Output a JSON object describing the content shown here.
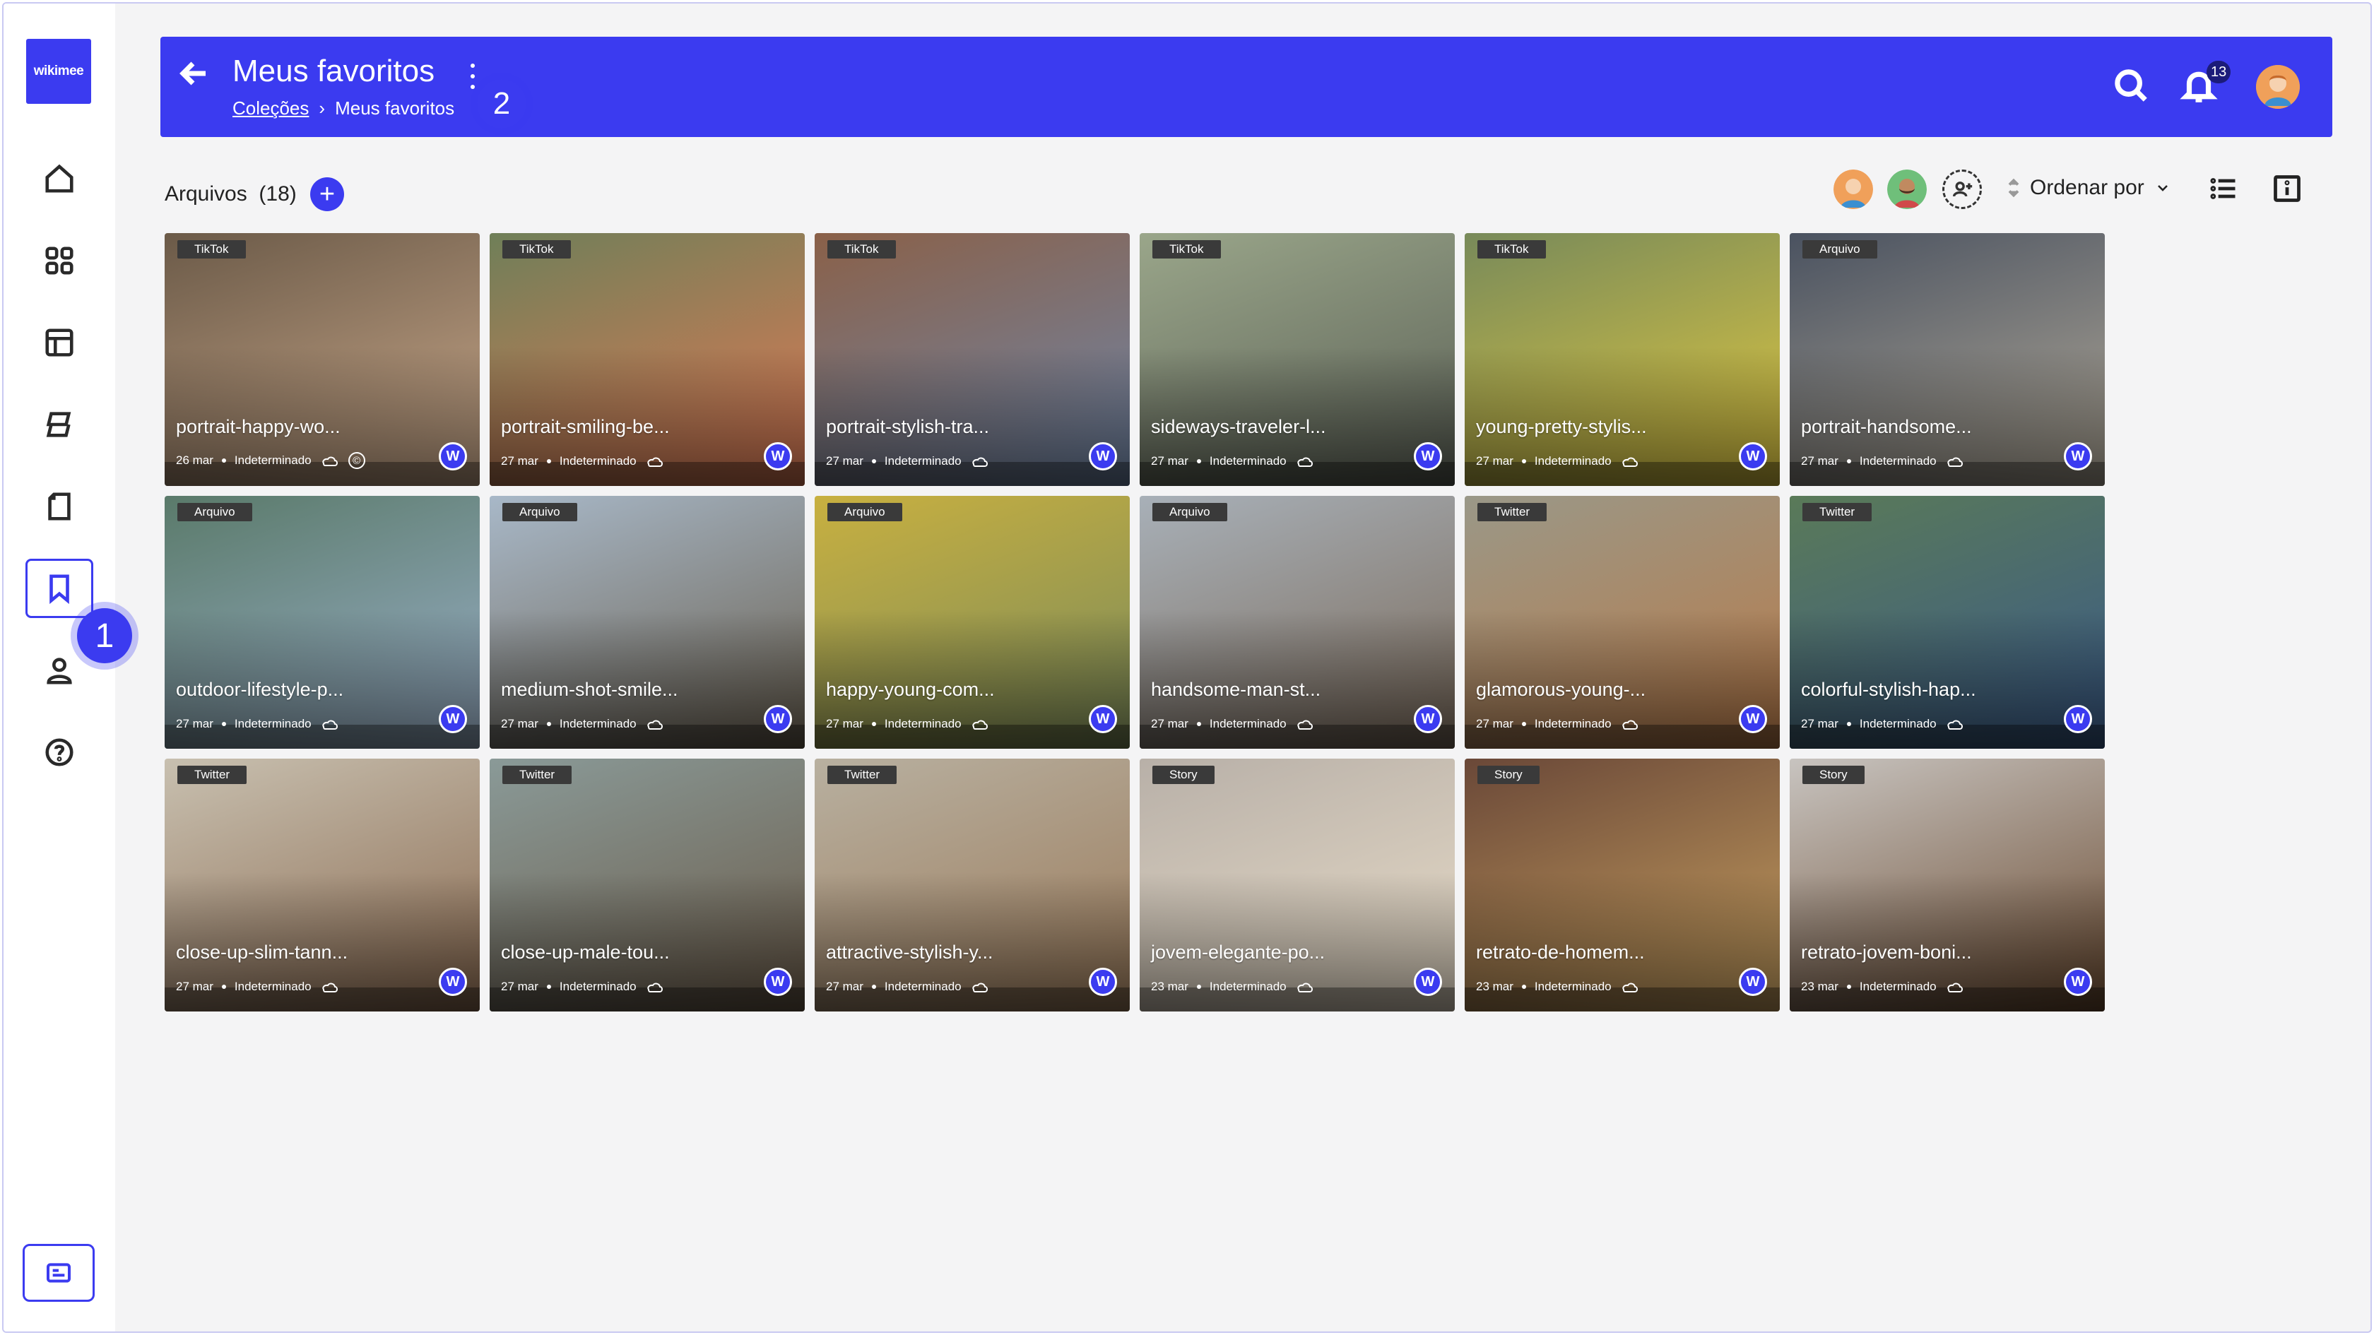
{
  "app": {
    "logo": "wikimee"
  },
  "sidebar": {
    "items": [
      {
        "name": "home",
        "icon": "home-icon",
        "active": false
      },
      {
        "name": "apps",
        "icon": "grid-icon",
        "active": false
      },
      {
        "name": "layout",
        "icon": "layout-icon",
        "active": false
      },
      {
        "name": "boards",
        "icon": "stack-icon",
        "active": false
      },
      {
        "name": "pages",
        "icon": "page-icon",
        "active": false
      },
      {
        "name": "favorites",
        "icon": "bookmark-icon",
        "active": true
      },
      {
        "name": "profile",
        "icon": "user-icon",
        "active": false
      },
      {
        "name": "help",
        "icon": "help-icon",
        "active": false
      }
    ],
    "step1": "1"
  },
  "header": {
    "title": "Meus favoritos",
    "breadcrumb_link": "Coleções",
    "breadcrumb_sep": "›",
    "breadcrumb_current": "Meus favoritos",
    "step2": "2",
    "notifications": "13"
  },
  "toolbar": {
    "files_label": "Arquivos",
    "files_count": "(18)",
    "add_label": "+",
    "sort_label": "Ordenar por"
  },
  "cards": [
    {
      "tag": "TikTok",
      "name": "portrait-happy-wo...",
      "date": "26 mar",
      "status": "Indeterminado",
      "copyright": true,
      "colors": [
        "#6b5a48",
        "#c9a88a"
      ]
    },
    {
      "tag": "TikTok",
      "name": "portrait-smiling-be...",
      "date": "27 mar",
      "status": "Indeterminado",
      "copyright": false,
      "colors": [
        "#6f7f58",
        "#e07a55"
      ]
    },
    {
      "tag": "TikTok",
      "name": "portrait-stylish-tra...",
      "date": "27 mar",
      "status": "Indeterminado",
      "copyright": false,
      "colors": [
        "#8a6048",
        "#6f86a8"
      ]
    },
    {
      "tag": "TikTok",
      "name": "sideways-traveler-l...",
      "date": "27 mar",
      "status": "Indeterminado",
      "copyright": false,
      "colors": [
        "#9aa68a",
        "#5a5f55"
      ]
    },
    {
      "tag": "TikTok",
      "name": "young-pretty-stylis...",
      "date": "27 mar",
      "status": "Indeterminado",
      "copyright": false,
      "colors": [
        "#788a5a",
        "#e0c840"
      ]
    },
    {
      "tag": "Arquivo",
      "name": "portrait-handsome...",
      "date": "27 mar",
      "status": "Indeterminado",
      "copyright": false,
      "colors": [
        "#4a5260",
        "#b0a898"
      ]
    },
    {
      "tag": "Arquivo",
      "name": "outdoor-lifestyle-p...",
      "date": "27 mar",
      "status": "Indeterminado",
      "copyright": false,
      "colors": [
        "#5a7a6a",
        "#9ab0c8"
      ]
    },
    {
      "tag": "Arquivo",
      "name": "medium-shot-smile...",
      "date": "27 mar",
      "status": "Indeterminado",
      "copyright": false,
      "colors": [
        "#a8b8c8",
        "#6a6050"
      ]
    },
    {
      "tag": "Arquivo",
      "name": "happy-young-com...",
      "date": "27 mar",
      "status": "Indeterminado",
      "copyright": false,
      "colors": [
        "#c8b040",
        "#7a8a5a"
      ]
    },
    {
      "tag": "Arquivo",
      "name": "handsome-man-st...",
      "date": "27 mar",
      "status": "Indeterminado",
      "copyright": false,
      "colors": [
        "#a8b0b8",
        "#7a6a5a"
      ]
    },
    {
      "tag": "Twitter",
      "name": "glamorous-young-...",
      "date": "27 mar",
      "status": "Indeterminado",
      "copyright": false,
      "colors": [
        "#9a9888",
        "#b87a48"
      ]
    },
    {
      "tag": "Twitter",
      "name": "colorful-stylish-hap...",
      "date": "27 mar",
      "status": "Indeterminado",
      "copyright": false,
      "colors": [
        "#5a7a58",
        "#3a5a88"
      ]
    },
    {
      "tag": "Twitter",
      "name": "close-up-slim-tann...",
      "date": "27 mar",
      "status": "Indeterminado",
      "copyright": false,
      "colors": [
        "#c8c0b0",
        "#8a6a50"
      ]
    },
    {
      "tag": "Twitter",
      "name": "close-up-male-tou...",
      "date": "27 mar",
      "status": "Indeterminado",
      "copyright": false,
      "colors": [
        "#8a9a98",
        "#6a5a48"
      ]
    },
    {
      "tag": "Twitter",
      "name": "attractive-stylish-y...",
      "date": "27 mar",
      "status": "Indeterminado",
      "copyright": false,
      "colors": [
        "#b8b0a0",
        "#9a7a5a"
      ]
    },
    {
      "tag": "Story",
      "name": "jovem-elegante-po...",
      "date": "23 mar",
      "status": "Indeterminado",
      "copyright": false,
      "colors": [
        "#b8b0a8",
        "#e8dcc8"
      ]
    },
    {
      "tag": "Story",
      "name": "retrato-de-homem...",
      "date": "23 mar",
      "status": "Indeterminado",
      "copyright": false,
      "colors": [
        "#6a4838",
        "#c8a060"
      ]
    },
    {
      "tag": "Story",
      "name": "retrato-jovem-boni...",
      "date": "23 mar",
      "status": "Indeterminado",
      "copyright": false,
      "colors": [
        "#c8c4c0",
        "#6a4a30"
      ]
    }
  ],
  "colors": {
    "accent": "#3b3bf0",
    "background": "#f4f4f5"
  }
}
